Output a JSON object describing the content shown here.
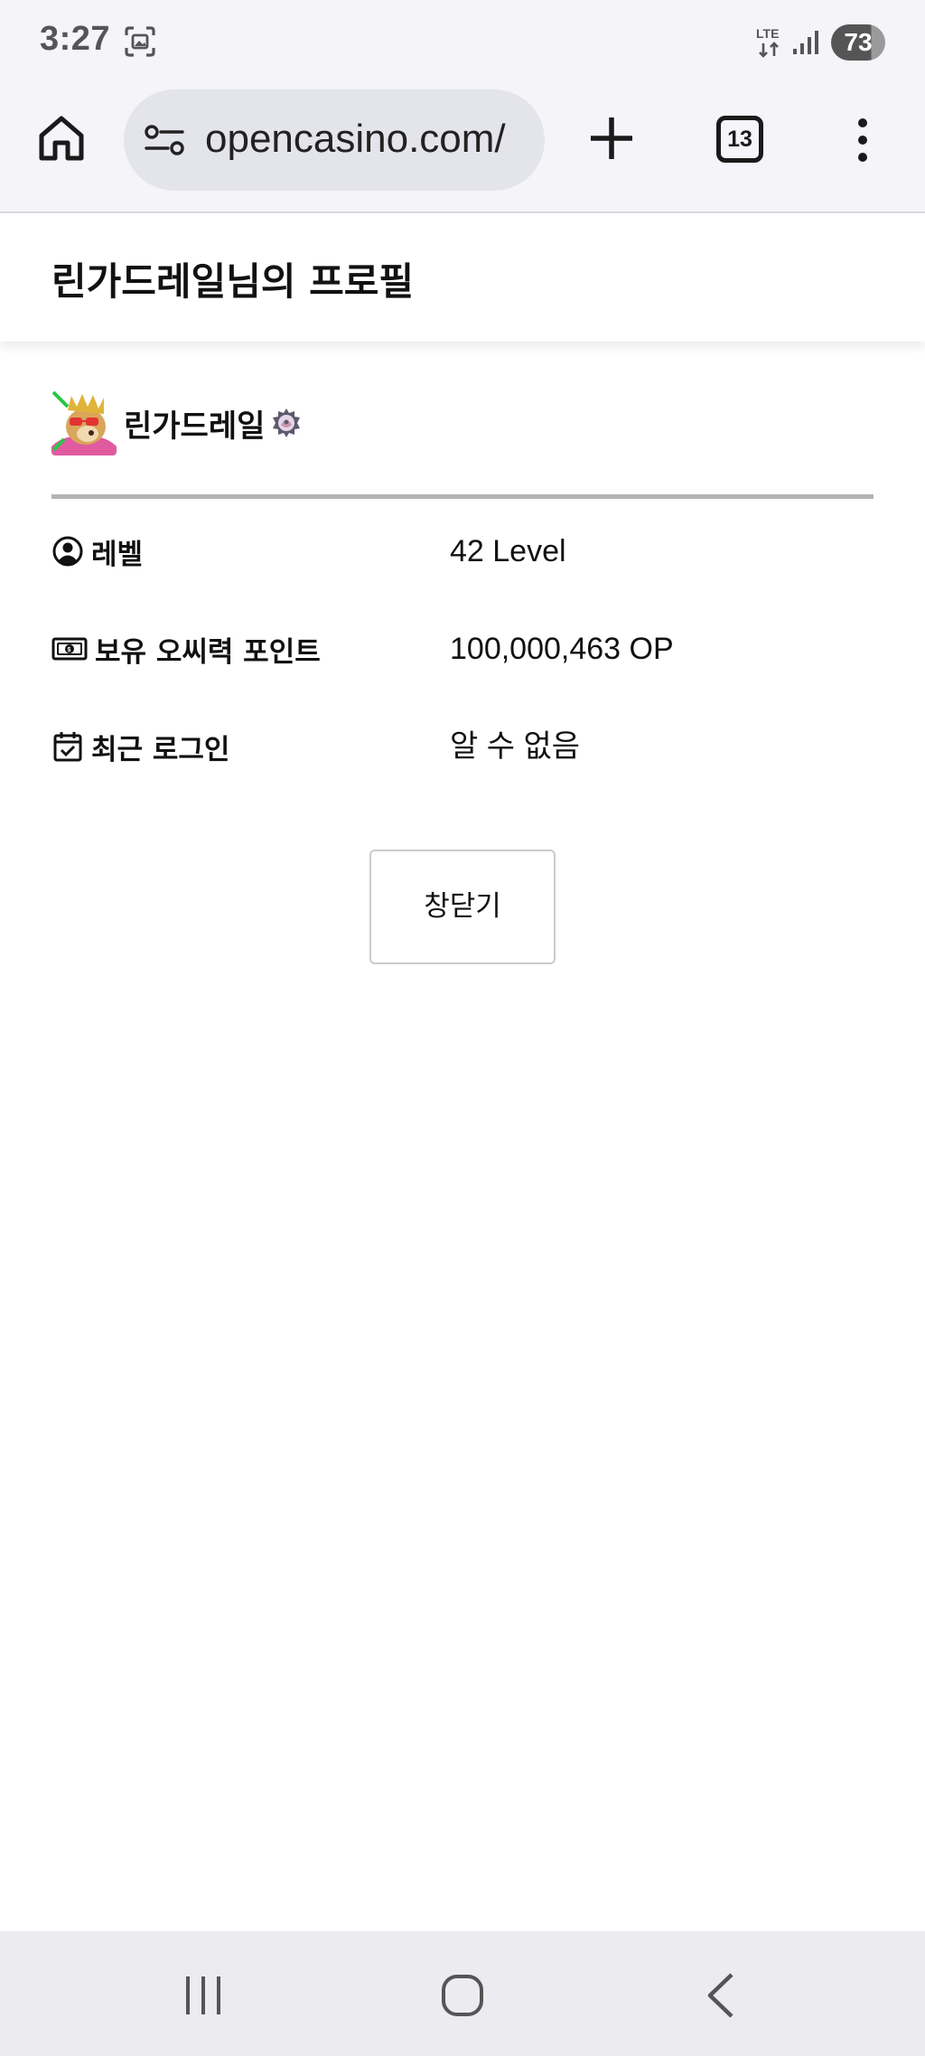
{
  "status_bar": {
    "time": "3:27",
    "network": "LTE",
    "battery": "73",
    "icons": [
      "screenshot-icon",
      "lte-icon",
      "signal-icon",
      "battery-icon"
    ]
  },
  "browser": {
    "url": "opencasino.com/",
    "tab_count": "13",
    "icons": [
      "home-icon",
      "site-settings-icon",
      "plus-icon",
      "tabs-icon",
      "more-vert-icon"
    ]
  },
  "page": {
    "title": "린가드레일님의 프로필"
  },
  "profile": {
    "username": "린가드레일",
    "rows": [
      {
        "icon": "user-circle-icon",
        "label": "레벨",
        "value": "42 Level"
      },
      {
        "icon": "money-icon",
        "label": "보유 오씨력 포인트",
        "value": "100,000,463 OP"
      },
      {
        "icon": "calendar-check-icon",
        "label": "최근 로그인",
        "value": "알 수 없음"
      }
    ]
  },
  "actions": {
    "close_label": "창닫기"
  },
  "nav": {
    "icons": [
      "recents-icon",
      "home-icon",
      "back-icon"
    ]
  },
  "colors": {
    "chrome_bg": "#f4f4f9",
    "url_bar_bg": "#e4e4eb",
    "divider": "#b4b4b4",
    "nav_bg": "#ebebf0",
    "text": "#111111"
  }
}
